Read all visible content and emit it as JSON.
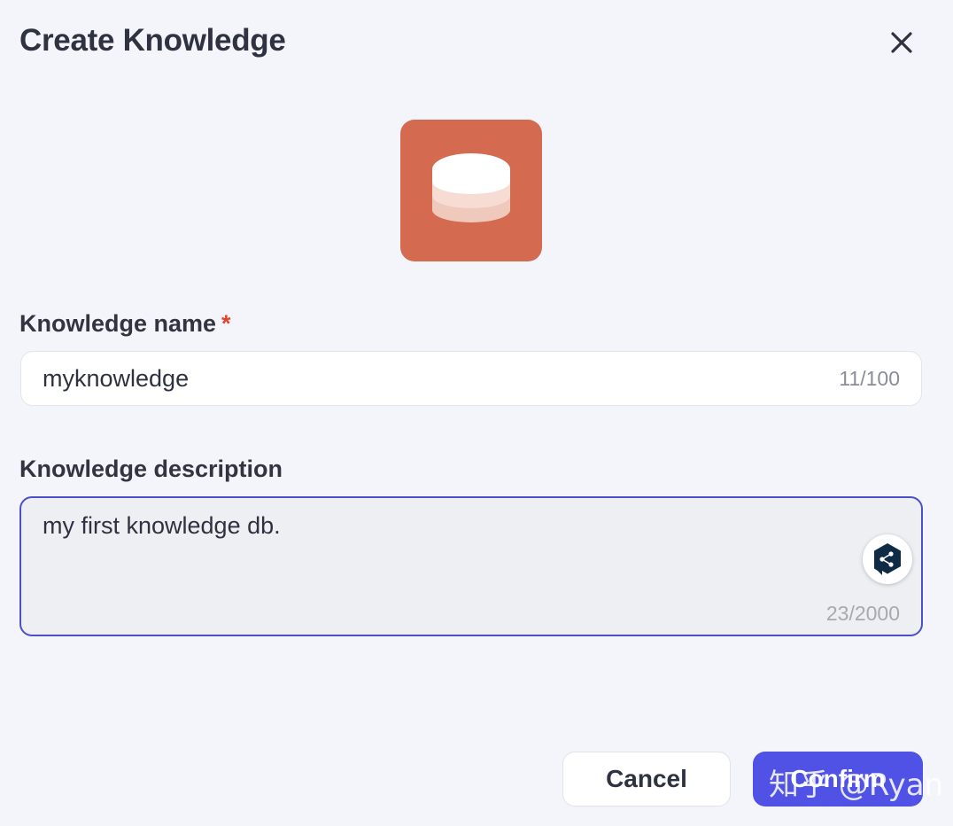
{
  "dialog": {
    "title": "Create Knowledge",
    "close_icon": "close-icon"
  },
  "knowledge_icon": {
    "icon": "database-icon",
    "background_color": "#d46a50"
  },
  "name_field": {
    "label": "Knowledge name",
    "required_marker": "*",
    "value": "myknowledge",
    "counter": "11/100"
  },
  "description_field": {
    "label": "Knowledge description",
    "value": "my first knowledge db.",
    "counter": "23/2000",
    "focused_border_color": "#4b50c8"
  },
  "translate_widget": {
    "icon": "deepl-icon"
  },
  "footer": {
    "cancel_label": "Cancel",
    "confirm_label": "Confirm",
    "confirm_color": "#4f52e4"
  },
  "watermark": {
    "text": "知乎 @Ryan"
  }
}
